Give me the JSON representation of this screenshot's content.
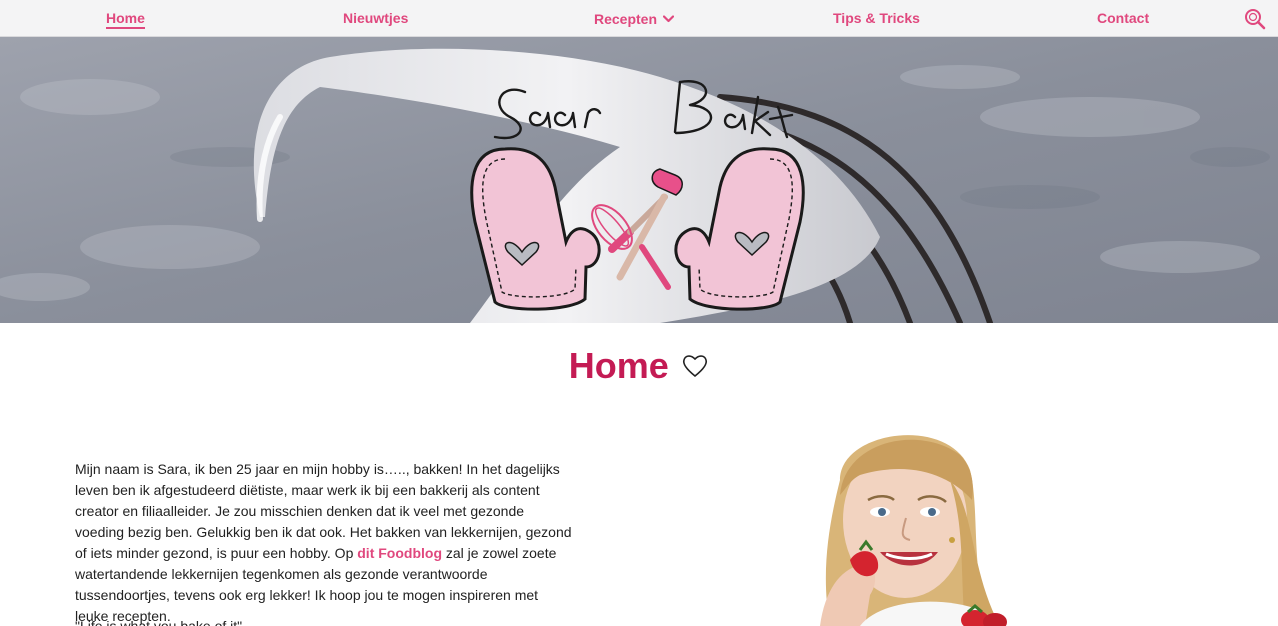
{
  "nav": {
    "items": [
      {
        "label": "Home",
        "active": true
      },
      {
        "label": "Nieuwtjes"
      },
      {
        "label": "Recepten",
        "has_dropdown": true
      },
      {
        "label": "Tips & Tricks"
      },
      {
        "label": "Contact"
      }
    ],
    "search_icon": "search-icon"
  },
  "hero": {
    "logo_text": "Saar Bakt",
    "logo_icons": [
      "oven-mitt-icon",
      "whisk-icon",
      "spatula-icon",
      "heart-icon"
    ]
  },
  "page": {
    "title": "Home",
    "title_icon": "heart-outline-icon"
  },
  "intro": {
    "text_before_link": "Mijn naam is Sara, ik ben 25 jaar en mijn hobby is….., bakken! In het dagelijks leven ben ik afgestudeerd diëtiste, maar werk ik bij een bakkerij als content creator en filiaalleider. Je zou misschien denken dat ik veel met gezonde voeding bezig ben. Gelukkig ben ik dat ook. Het bakken van lekkernijen, gezond of iets minder gezond, is puur een hobby. Op ",
    "link_text": "dit Foodblog",
    "text_after_link": " zal je zowel zoete watertandende lekkernijen tegenkomen als gezonde verantwoorde tussendoortjes, tevens ook erg lekker! Ik hoop jou te mogen inspireren met leuke recepten.",
    "next_line": "\"Life is what you bake of it\""
  },
  "colors": {
    "accent": "#e0487e",
    "title": "#c41b54",
    "mitt_pink": "#f2c4d6",
    "nav_bg": "#f4f4f5"
  }
}
